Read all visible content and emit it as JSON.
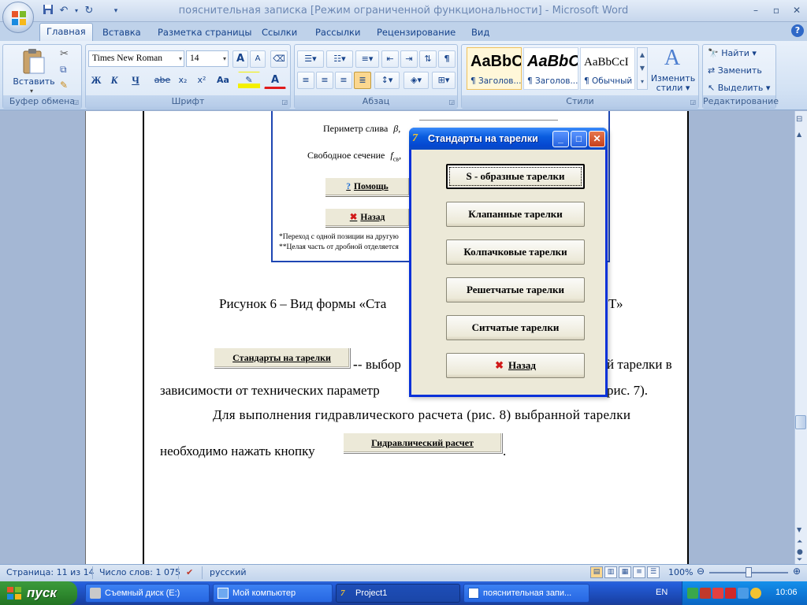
{
  "window": {
    "title": "пояснительная записка [Режим ограниченной функциональности] - Microsoft Word"
  },
  "qat": {
    "save_icon": "save-icon",
    "undo_icon": "undo-icon",
    "redo_icon": "redo-icon"
  },
  "tabs": [
    "Главная",
    "Вставка",
    "Разметка страницы",
    "Ссылки",
    "Рассылки",
    "Рецензирование",
    "Вид"
  ],
  "ribbon": {
    "clipboard": {
      "label": "Буфер обмена",
      "paste": "Вставить"
    },
    "font": {
      "label": "Шрифт",
      "font_name": "Times New Roman",
      "font_size": "14",
      "bold": "Ж",
      "italic": "К",
      "underline": "Ч",
      "strike": "abe",
      "subscript": "x₂",
      "superscript": "x²",
      "change_case": "Aa",
      "grow": "A",
      "shrink": "A",
      "font_color": "A"
    },
    "paragraph": {
      "label": "Абзац"
    },
    "styles": {
      "label": "Стили",
      "tiles": [
        {
          "sample": "AaBbC",
          "name": "¶ Заголов..."
        },
        {
          "sample": "AaBbC",
          "name": "¶ Заголов..."
        },
        {
          "sample": "AaBbCcI",
          "name": "¶ Обычный"
        }
      ],
      "change_styles_line1": "Изменить",
      "change_styles_line2": "стили"
    },
    "editing": {
      "label": "Редактирование",
      "find": "Найти",
      "replace": "Заменить",
      "select": "Выделить"
    }
  },
  "figure": {
    "perimeter_label": "Периметр слива",
    "perimeter_symbol": "β,",
    "free_section_label": "Свободное сечение",
    "free_section_symbol": "f",
    "help_button": "Помощь",
    "back_button": "Назад",
    "note1": "*Переход с одной позиции на другую",
    "note2": "**Целая часть от дробной отделяется"
  },
  "document": {
    "caption": "Рисунок 6 – Вид формы «Ста",
    "caption_end": "Т»",
    "inline_button1": "Стандарты на тарелки",
    "line1_text": "- выбор",
    "line1_end": "й тарелки в",
    "line2_text": "зависимости от технических параметр",
    "line2_end": "рис. 7).",
    "line3_text": "Для выполнения гидравлического расчета (рис. 8) выбранной тарелки",
    "line4_text": "необходимо нажать кнопку",
    "inline_button2": "Гидравлический расчет",
    "line4_end": "."
  },
  "dialog": {
    "title": "Стандарты на тарелки",
    "buttons": [
      "S - образные тарелки",
      "Клапанные тарелки",
      "Колпачковые тарелки",
      "Решетчатые тарелки",
      "Ситчатые тарелки",
      "Назад"
    ]
  },
  "statusbar": {
    "page": "Страница: 11 из 14",
    "words": "Число слов: 1 075",
    "language": "русский",
    "zoom": "100%"
  },
  "taskbar": {
    "start": "пуск",
    "tasks": [
      "Съемный диск (E:)",
      "Мой компьютер",
      "Project1",
      "пояснительная запи..."
    ],
    "lang": "EN",
    "clock": "10:06"
  },
  "colors": {
    "xp_blue": "#0831d9",
    "ribbon_blue": "#15428b",
    "start_green": "#2f8a2f"
  }
}
